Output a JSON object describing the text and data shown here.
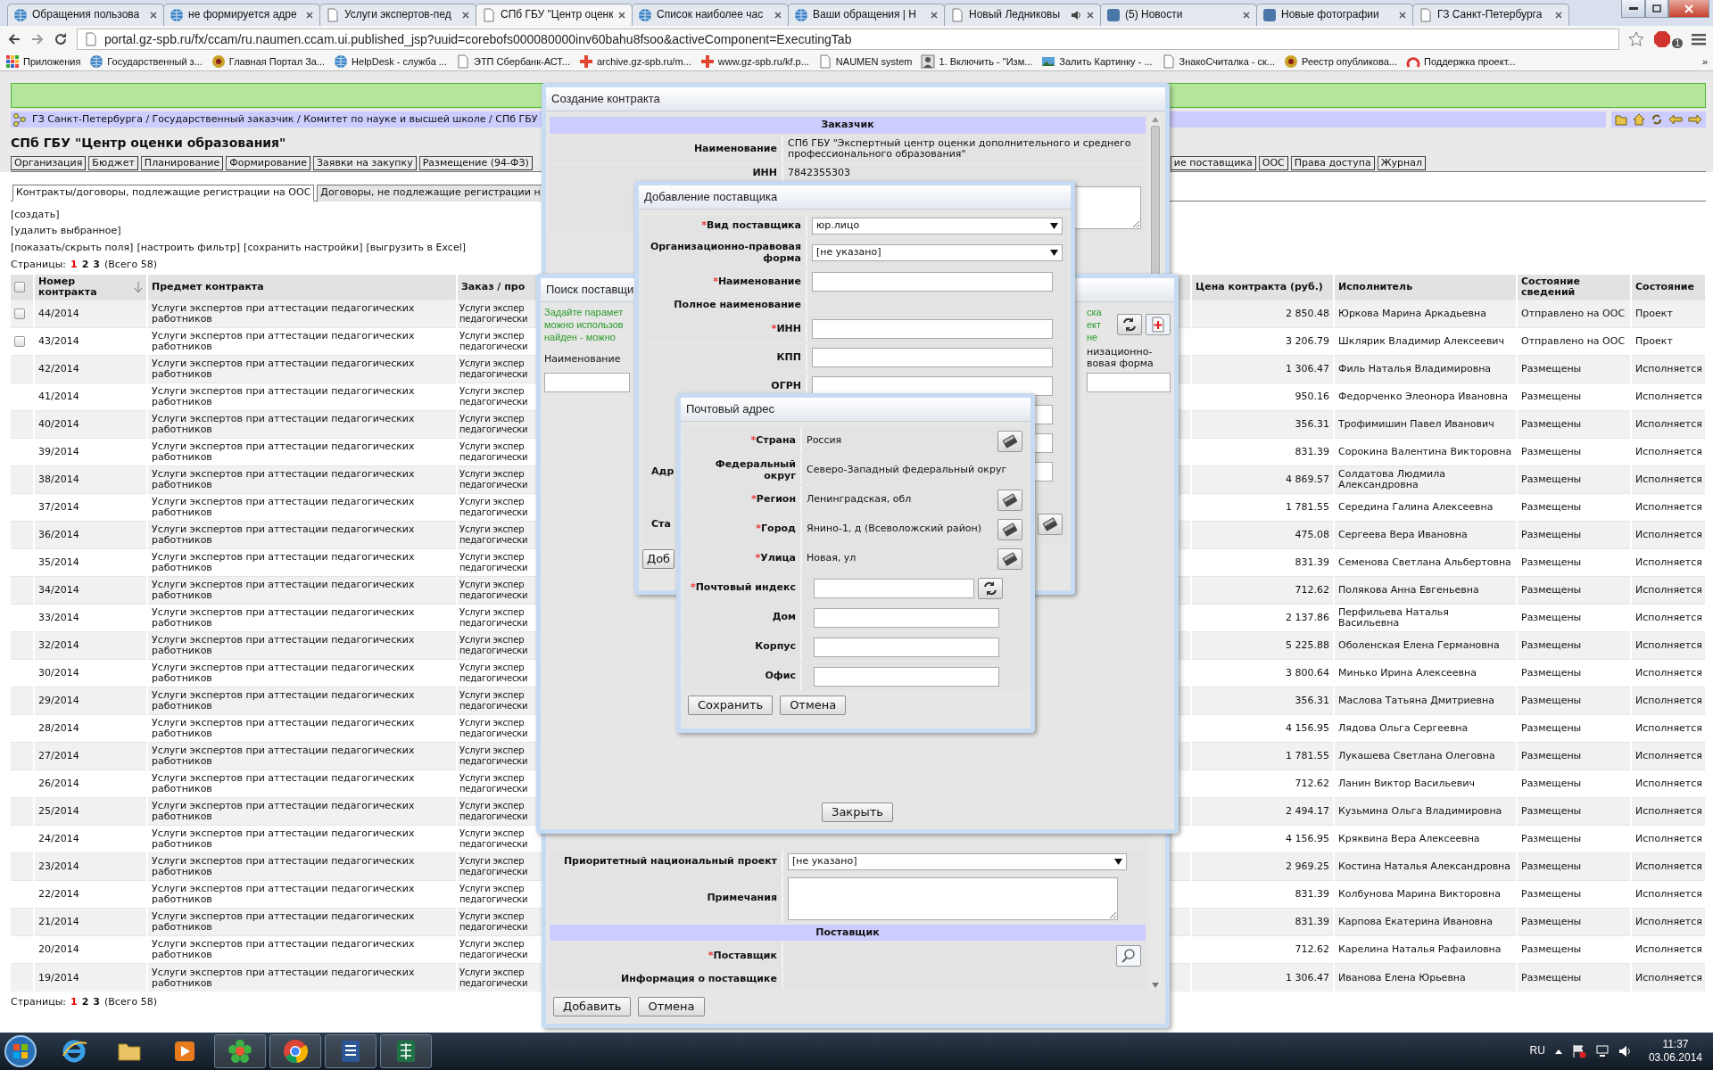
{
  "browser": {
    "tabs": [
      {
        "title": "Обращения пользова",
        "kind": "globe",
        "selected": false
      },
      {
        "title": "не формируется адре",
        "kind": "globe",
        "selected": false
      },
      {
        "title": "Услуги экспертов-пед",
        "kind": "page",
        "selected": false
      },
      {
        "title": "СПб ГБУ \"Центр оценк",
        "kind": "page",
        "selected": true
      },
      {
        "title": "Список наиболее час",
        "kind": "globe",
        "selected": false
      },
      {
        "title": "Ваши обращения | Н",
        "kind": "globe",
        "selected": false
      },
      {
        "title": "Новый Ледниковы",
        "kind": "page",
        "selected": false,
        "sound": true
      },
      {
        "title": "(5) Новости",
        "kind": "logo",
        "selected": false
      },
      {
        "title": "Новые фотографии",
        "kind": "logo",
        "selected": false
      },
      {
        "title": "ГЗ Санкт-Петербурга",
        "kind": "page",
        "selected": false
      }
    ],
    "address": "portal.gz-spb.ru/fx/ccam/ru.naumen.ccam.ui.published_jsp?uuid=corebofs000080000inv60bahu8fsoo&activeComponent=ExecutingTab",
    "extension_count": "1",
    "bookmarks": [
      {
        "label": "Приложения",
        "kind": "apps"
      },
      {
        "label": "Государственный з...",
        "kind": "globe"
      },
      {
        "label": "Главная Портал За...",
        "kind": "emblem"
      },
      {
        "label": "HelpDesk - служба ...",
        "kind": "globe"
      },
      {
        "label": "ЭТП Сбербанк-АСТ...",
        "kind": "page"
      },
      {
        "label": "archive.gz-spb.ru/m...",
        "kind": "cross"
      },
      {
        "label": "www.gz-spb.ru/kf.p...",
        "kind": "cross"
      },
      {
        "label": "NAUMEN system",
        "kind": "page"
      },
      {
        "label": "1. Включить - \"Изм...",
        "kind": "person"
      },
      {
        "label": "Залить Картинку - ...",
        "kind": "photo"
      },
      {
        "label": "ЗнакоСчиталка - ск...",
        "kind": "page"
      },
      {
        "label": "Реестр опубликова...",
        "kind": "emblem"
      },
      {
        "label": "Поддержка проект...",
        "kind": "arc"
      }
    ],
    "bookmarks_more": "»"
  },
  "page": {
    "breadcrumb": "ГЗ Санкт-Петербурга / Государственный заказчик / Комитет по науке и высшей школе / СПб ГБУ",
    "org_title": "СПб ГБУ \"Центр оценки образования\"",
    "nav_left": [
      "Организация",
      "Бюджет",
      "Планирование",
      "Формирование",
      "Заявки на закупку",
      "Размещение (94-ФЗ)"
    ],
    "nav_right": [
      "ие поставщика",
      "ООС",
      "Права доступа",
      "Журнал"
    ],
    "sub_tabs": [
      {
        "label": "Контракты/договоры, подлежащие регистрации на ООС",
        "selected": true
      },
      {
        "label": "Договоры, не подлежащие регистрации н",
        "selected": false
      }
    ],
    "actions": [
      [
        "[создать]"
      ],
      [
        "[удалить выбранное]"
      ],
      [
        "[показать/скрыть поля]",
        "[настроить фильтр]",
        "[сохранить настройки]",
        "[выгрузить в Excel]"
      ]
    ],
    "pages_top": {
      "label": "Страницы:",
      "items": [
        {
          "label": "1",
          "selected": true
        },
        {
          "label": "2",
          "selected": false
        },
        {
          "label": "3",
          "selected": false
        }
      ],
      "total": "(Всего 58)"
    },
    "table": {
      "select_all": {
        "checked": false
      },
      "columns": [
        {
          "label": "Номер контракта",
          "sorted": true
        },
        {
          "label": "Предмет контракта",
          "sorted": false
        },
        {
          "label": "Заказ / про",
          "sorted": false
        },
        {
          "label": "Цена контракта (руб.)",
          "sorted": false
        },
        {
          "label": "Исполнитель",
          "sorted": false
        },
        {
          "label": "Состояние сведений",
          "sorted": false
        },
        {
          "label": "Состояние",
          "sorted": false
        }
      ],
      "rows": [
        {
          "checked": false,
          "number": "44/2014",
          "subject": "Услуги экспертов при аттестации педагогических работников",
          "column_3": "Услуги экспер\nпедагогически",
          "price": "2 850.48",
          "executor": "Юркова Марина Аркадьевна",
          "info_state": "Отправлено на ООС",
          "state": "Проект"
        },
        {
          "checked": false,
          "number": "43/2014",
          "subject": "Услуги экспертов при аттестации педагогических работников",
          "column_3": "Услуги экспер\nпедагогически",
          "price": "3 206.79",
          "executor": "Шклярик Владимир Алексеевич",
          "info_state": "Отправлено на ООС",
          "state": "Проект"
        },
        {
          "number": "42/2014",
          "subject": "Услуги экспертов при аттестации педагогических работников",
          "column_3": "Услуги экспер\nпедагогически",
          "price": "1 306.47",
          "executor": "Филь Наталья Владимировна",
          "info_state": "Размещены",
          "state": "Исполняется"
        },
        {
          "number": "41/2014",
          "subject": "Услуги экспертов при аттестации педагогических работников",
          "column_3": "Услуги экспер\nпедагогически",
          "price": "950.16",
          "executor": "Федорченко Элеонора Ивановна",
          "info_state": "Размещены",
          "state": "Исполняется"
        },
        {
          "number": "40/2014",
          "subject": "Услуги экспертов при аттестации педагогических работников",
          "column_3": "Услуги экспер\nпедагогически",
          "price": "356.31",
          "executor": "Трофимишин Павел Иванович",
          "info_state": "Размещены",
          "state": "Исполняется"
        },
        {
          "number": "39/2014",
          "subject": "Услуги экспертов при аттестации педагогических работников",
          "column_3": "Услуги экспер\nпедагогически",
          "price": "831.39",
          "executor": "Сорокина Валентина Викторовна",
          "info_state": "Размещены",
          "state": "Исполняется"
        },
        {
          "number": "38/2014",
          "subject": "Услуги экспертов при аттестации педагогических работников",
          "column_3": "Услуги экспер\nпедагогически",
          "price": "4 869.57",
          "executor": "Солдатова Людмила Александровна",
          "info_state": "Размещены",
          "state": "Исполняется"
        },
        {
          "number": "37/2014",
          "subject": "Услуги экспертов при аттестации педагогических работников",
          "column_3": "Услуги экспер\nпедагогически",
          "price": "1 781.55",
          "executor": "Середина Галина Алексеевна",
          "info_state": "Размещены",
          "state": "Исполняется"
        },
        {
          "number": "36/2014",
          "subject": "Услуги экспертов при аттестации педагогических работников",
          "column_3": "Услуги экспер\nпедагогически",
          "price": "475.08",
          "executor": "Сергеева Вера Ивановна",
          "info_state": "Размещены",
          "state": "Исполняется"
        },
        {
          "number": "35/2014",
          "subject": "Услуги экспертов при аттестации педагогических работников",
          "column_3": "Услуги экспер\nпедагогически",
          "price": "831.39",
          "executor": "Семенова Светлана Альбертовна",
          "info_state": "Размещены",
          "state": "Исполняется"
        },
        {
          "number": "34/2014",
          "subject": "Услуги экспертов при аттестации педагогических работников",
          "column_3": "Услуги экспер\nпедагогически",
          "price": "712.62",
          "executor": "Полякова Анна Евгеньевна",
          "info_state": "Размещены",
          "state": "Исполняется"
        },
        {
          "number": "33/2014",
          "subject": "Услуги экспертов при аттестации педагогических работников",
          "column_3": "Услуги экспер\nпедагогически",
          "price": "2 137.86",
          "executor": "Перфильева Наталья Васильевна",
          "info_state": "Размещены",
          "state": "Исполняется"
        },
        {
          "number": "32/2014",
          "subject": "Услуги экспертов при аттестации педагогических работников",
          "column_3": "Услуги экспер\nпедагогически",
          "price": "5 225.88",
          "executor": "Оболенская Елена Германовна",
          "info_state": "Размещены",
          "state": "Исполняется"
        },
        {
          "number": "30/2014",
          "subject": "Услуги экспертов при аттестации педагогических работников",
          "column_3": "Услуги экспер\nпедагогически",
          "price": "3 800.64",
          "executor": "Минько Ирина Алексеевна",
          "info_state": "Размещены",
          "state": "Исполняется"
        },
        {
          "number": "29/2014",
          "subject": "Услуги экспертов при аттестации педагогических работников",
          "column_3": "Услуги экспер\nпедагогически",
          "price": "356.31",
          "executor": "Маслова Татьяна Дмитриевна",
          "info_state": "Размещены",
          "state": "Исполняется"
        },
        {
          "number": "28/2014",
          "subject": "Услуги экспертов при аттестации педагогических работников",
          "column_3": "Услуги экспер\nпедагогически",
          "price": "4 156.95",
          "executor": "Лядова Ольга Сергеевна",
          "info_state": "Размещены",
          "state": "Исполняется"
        },
        {
          "number": "27/2014",
          "subject": "Услуги экспертов при аттестации педагогических работников",
          "column_3": "Услуги экспер\nпедагогически",
          "price": "1 781.55",
          "executor": "Лукашева Светлана Олеговна",
          "info_state": "Размещены",
          "state": "Исполняется"
        },
        {
          "number": "26/2014",
          "subject": "Услуги экспертов при аттестации педагогических работников",
          "column_3": "Услуги экспер\nпедагогически",
          "price": "712.62",
          "executor": "Ланин Виктор Васильевич",
          "info_state": "Размещены",
          "state": "Исполняется"
        },
        {
          "number": "25/2014",
          "subject": "Услуги экспертов при аттестации педагогических работников",
          "column_3": "Услуги экспер\nпедагогически",
          "price": "2 494.17",
          "executor": "Кузьмина Ольга Владимировна",
          "info_state": "Размещены",
          "state": "Исполняется"
        },
        {
          "number": "24/2014",
          "subject": "Услуги экспертов при аттестации педагогических работников",
          "column_3": "Услуги экспер\nпедагогически",
          "price": "4 156.95",
          "executor": "Кряквина Вера Алексеевна",
          "info_state": "Размещены",
          "state": "Исполняется"
        },
        {
          "number": "23/2014",
          "subject": "Услуги экспертов при аттестации педагогических работников",
          "column_3": "Услуги экспер\nпедагогически",
          "price": "2 969.25",
          "executor": "Костина Наталья Александровна",
          "info_state": "Размещены",
          "state": "Исполняется"
        },
        {
          "number": "22/2014",
          "subject": "Услуги экспертов при аттестации педагогических работников",
          "column_3": "Услуги экспер\nпедагогически",
          "price": "831.39",
          "executor": "Колбунова Марина Викторовна",
          "info_state": "Размещены",
          "state": "Исполняется"
        },
        {
          "number": "21/2014",
          "subject": "Услуги экспертов при аттестации педагогических работников",
          "column_3": "Услуги экспер\nпедагогически",
          "price": "831.39",
          "executor": "Карпова Екатерина Ивановна",
          "info_state": "Размещены",
          "state": "Исполняется"
        },
        {
          "number": "20/2014",
          "subject": "Услуги экспертов при аттестации педагогических работников",
          "column_3": "Услуги экспер\nпедагогически",
          "price": "712.62",
          "executor": "Карелина Наталья Рафаиловна",
          "info_state": "Размещены",
          "state": "Исполняется"
        },
        {
          "number": "19/2014",
          "subject": "Услуги экспертов при аттестации педагогических работников",
          "column_3": "Услуги экспер\nпедагогически",
          "price": "1 306.47",
          "executor": "Иванова Елена Юрьевна",
          "info_state": "Размещены",
          "state": "Исполняется"
        }
      ]
    },
    "pages_bottom": {
      "label": "Страницы:",
      "items": [
        {
          "label": "1",
          "selected": true
        },
        {
          "label": "2",
          "selected": false
        },
        {
          "label": "3",
          "selected": false
        }
      ],
      "total": "(Всего 58)"
    }
  },
  "dialogs": {
    "create_contract": {
      "title": "Создание контракта",
      "top_rows": [
        {
          "kind": "header",
          "label": "Заказчик"
        },
        {
          "kind": "text",
          "label": "Наименование",
          "value": "СПб ГБУ \"Экспертный центр оценки дополнительного и среднего профессионального образования\""
        },
        {
          "kind": "text",
          "label": "ИНН",
          "value": "7842355303"
        },
        {
          "kind": "textarea"
        }
      ],
      "bottom_rows": [
        {
          "kind": "select",
          "label": "Приоритетный национальный проект",
          "value": "[не указано]"
        },
        {
          "kind": "textarea",
          "label": "Примечания"
        },
        {
          "kind": "header",
          "label": "Поставщик"
        },
        {
          "kind": "lookup",
          "mark": "*",
          "label": "Поставщик"
        },
        {
          "kind": "text",
          "label": "Информация о поставщике"
        }
      ],
      "buttons": [
        "Добавить",
        "Отмена"
      ]
    },
    "supplier_search": {
      "title": "Поиск поставщи",
      "hint_left": "Задайте парамет\nможно использов\nнайден - можно",
      "hint_right": "ска\nект не",
      "column_left": "Наименование",
      "column_right": "низационно-\nвовая форма",
      "button": "Закрыть"
    },
    "add_supplier": {
      "title": "Добавление поставщика",
      "rows": [
        {
          "kind": "select",
          "mark": "*",
          "label": "Вид поставщика",
          "value": "юр.лицо"
        },
        {
          "kind": "select",
          "label": "Организационно-правовая форма",
          "value": "[не указано]"
        },
        {
          "kind": "input",
          "mark": "*",
          "label": "Наименование"
        },
        {
          "kind": "label",
          "label": "Полное наименование"
        },
        {
          "kind": "input",
          "mark": "*",
          "label": "ИНН"
        },
        {
          "kind": "input",
          "label": "КПП"
        },
        {
          "kind": "input",
          "label": "ОГРН"
        },
        {
          "kind": "input"
        },
        {
          "kind": "input"
        },
        {
          "kind": "input",
          "label": "Адр",
          "cut": true
        },
        {
          "kind": "label"
        },
        {
          "kind": "lookup",
          "label": "Ста",
          "cut": true
        }
      ],
      "buttons": [
        "Доб"
      ]
    },
    "postal_address": {
      "title": "Почтовый адрес",
      "rows": [
        {
          "kind": "value",
          "mark": "*",
          "label": "Страна",
          "value": "Россия",
          "lookup": true
        },
        {
          "kind": "value",
          "label": "Федеральный округ",
          "value": "Северо-Западный федеральный округ",
          "lookup": false
        },
        {
          "kind": "value",
          "mark": "*",
          "label": "Регион",
          "value": "Ленинградская, обл",
          "lookup": true
        },
        {
          "kind": "value",
          "mark": "*",
          "label": "Город",
          "value": "Янино-1, д (Всеволожский район)",
          "lookup": true
        },
        {
          "kind": "value",
          "mark": "*",
          "label": "Улица",
          "value": "Новая, ул",
          "lookup": true
        },
        {
          "kind": "input",
          "mark": "*",
          "label": "Почтовый индекс",
          "refresh": true
        },
        {
          "kind": "input",
          "label": "Дом",
          "refresh": false
        },
        {
          "kind": "input",
          "label": "Корпус",
          "refresh": false
        },
        {
          "kind": "input",
          "label": "Офис",
          "refresh": false
        }
      ],
      "buttons": [
        "Сохранить",
        "Отмена"
      ]
    }
  },
  "taskbar": {
    "apps": [
      {
        "kind": "ie",
        "running": false
      },
      {
        "kind": "folder",
        "running": false
      },
      {
        "kind": "media",
        "running": false
      },
      {
        "kind": "flower",
        "running": true
      },
      {
        "kind": "chrome",
        "running": true
      },
      {
        "kind": "word",
        "running": true
      },
      {
        "kind": "excel",
        "running": true
      }
    ],
    "language": "RU",
    "time": "11:37",
    "date": "03.06.2014"
  }
}
